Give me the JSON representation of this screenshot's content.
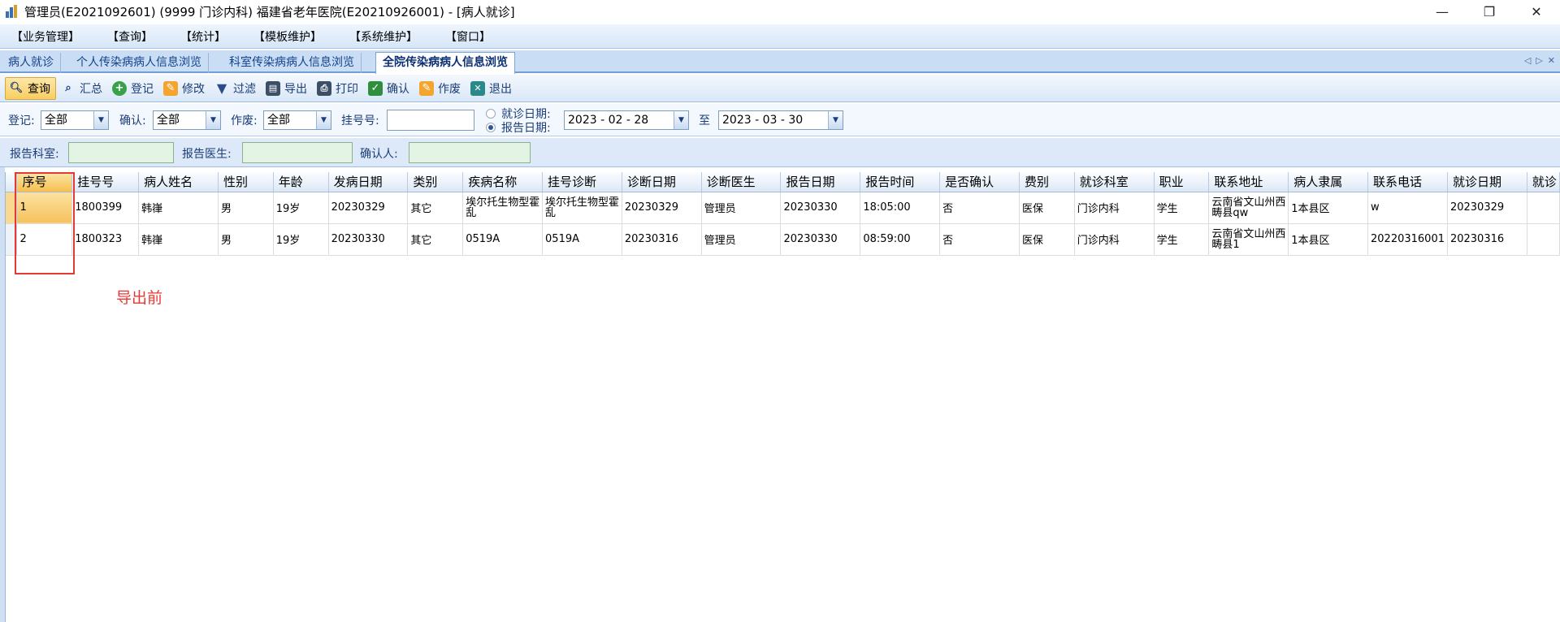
{
  "window": {
    "title": "管理员(E2021092601) (9999 门诊内科) 福建省老年医院(E20210926001) - [病人就诊]",
    "controls": [
      "—",
      "❐",
      "✕"
    ]
  },
  "menu": [
    "【业务管理】",
    "【查询】",
    "【统计】",
    "【模板维护】",
    "【系统维护】",
    "【窗口】"
  ],
  "tabs": [
    "病人就诊",
    "个人传染病病人信息浏览",
    "科室传染病病人信息浏览",
    "全院传染病病人信息浏览"
  ],
  "active_tab": "全院传染病病人信息浏览",
  "tab_nav": [
    "◁",
    "▷",
    "✕"
  ],
  "toolbar": [
    {
      "label": "查询",
      "icon": "search-icon"
    },
    {
      "label": "汇总",
      "icon": "summary-icon"
    },
    {
      "label": "登记",
      "icon": "add-icon"
    },
    {
      "label": "修改",
      "icon": "edit-icon"
    },
    {
      "label": "过滤",
      "icon": "filter-icon"
    },
    {
      "label": "导出",
      "icon": "export-icon"
    },
    {
      "label": "打印",
      "icon": "print-icon"
    },
    {
      "label": "确认",
      "icon": "confirm-icon"
    },
    {
      "label": "作废",
      "icon": "void-icon"
    },
    {
      "label": "退出",
      "icon": "exit-icon"
    }
  ],
  "filters": {
    "register_label": "登记:",
    "register_value": "全部",
    "confirm_label": "确认:",
    "confirm_value": "全部",
    "void_label": "作废:",
    "void_value": "全部",
    "reg_no_label": "挂号号:",
    "reg_no_value": "",
    "visit_date_label": "就诊日期:",
    "report_date_label": "报告日期:",
    "date_from": "2023 - 02 - 28",
    "to_label": "至",
    "date_to": "2023 - 03 - 30",
    "report_dept_label": "报告科室:",
    "report_doctor_label": "报告医生:",
    "confirmer_label": "确认人:"
  },
  "table": {
    "columns": [
      "序号",
      "挂号号",
      "病人姓名",
      "性别",
      "年龄",
      "发病日期",
      "类别",
      "疾病名称",
      "挂号诊断",
      "诊断日期",
      "诊断医生",
      "报告日期",
      "报告时间",
      "是否确认",
      "费别",
      "就诊科室",
      "职业",
      "联系地址",
      "病人隶属",
      "联系电话",
      "就诊日期",
      "就诊"
    ],
    "rows": [
      [
        "1",
        "1800399",
        "韩嵂",
        "男",
        "19岁",
        "20230329",
        "其它",
        "埃尔托生物型霍乱",
        "埃尔托生物型霍乱",
        "20230329",
        "管理员",
        "20230330",
        "18:05:00",
        "否",
        "医保",
        "门诊内科",
        "学生",
        "云南省文山州西畴县qw",
        "1本县区",
        "w",
        "20230329",
        ""
      ],
      [
        "2",
        "1800323",
        "韩嵂",
        "男",
        "19岁",
        "20230330",
        "其它",
        "0519A",
        "0519A",
        "20230316",
        "管理员",
        "20230330",
        "08:59:00",
        "否",
        "医保",
        "门诊内科",
        "学生",
        "云南省文山州西畴县1",
        "1本县区",
        "20220316001",
        "20230316",
        ""
      ]
    ]
  },
  "annotation": "导出前"
}
